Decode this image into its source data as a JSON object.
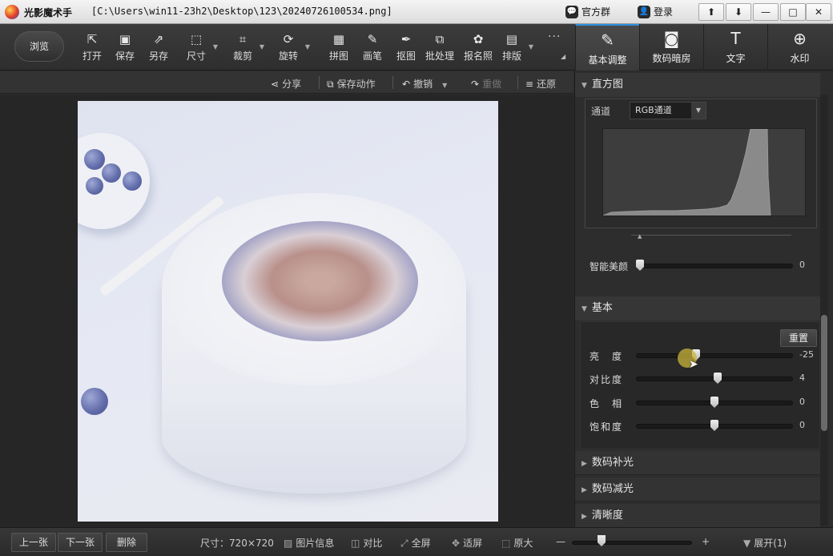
{
  "titlebar": {
    "app_title": "光影魔术手",
    "file_path": "[C:\\Users\\win11-23h2\\Desktop\\123\\20240726100534.png]",
    "official_group": "官方群",
    "login": "登录",
    "window_controls": [
      "⬆",
      "⬇",
      "—",
      "□",
      "✕"
    ]
  },
  "toolbar": {
    "browse_label": "浏览",
    "tools": [
      {
        "label": "打开",
        "icon": "open-icon"
      },
      {
        "label": "保存",
        "icon": "save-icon"
      },
      {
        "label": "另存",
        "icon": "save-as-icon"
      },
      {
        "label": "尺寸",
        "icon": "resize-icon"
      },
      {
        "label": "裁剪",
        "icon": "crop-icon"
      },
      {
        "label": "旋转",
        "icon": "rotate-icon"
      },
      {
        "label": "拼图",
        "icon": "collage-icon"
      },
      {
        "label": "画笔",
        "icon": "brush-icon"
      },
      {
        "label": "抠图",
        "icon": "cutout-icon"
      },
      {
        "label": "批处理",
        "icon": "batch-icon"
      },
      {
        "label": "报名照",
        "icon": "id-photo-icon"
      },
      {
        "label": "排版",
        "icon": "layout-icon"
      }
    ],
    "more": "···"
  },
  "right_tabs": [
    {
      "label": "基本调整",
      "icon": "adjust-icon"
    },
    {
      "label": "数码暗房",
      "icon": "darkroom-icon"
    },
    {
      "label": "文字",
      "icon": "text-icon"
    },
    {
      "label": "水印",
      "icon": "watermark-icon"
    }
  ],
  "subbar": {
    "share": "分享",
    "save_action": "保存动作",
    "undo": "撤销",
    "redo": "重做",
    "restore": "还原"
  },
  "histogram": {
    "title": "直方图",
    "channel_label": "通道",
    "channel_value": "RGB通道",
    "smart_beauty_label": "智能美颜",
    "smart_beauty_value": "0"
  },
  "basic": {
    "title": "基本",
    "reset": "重置",
    "sliders": [
      {
        "label": "亮　度",
        "value": "-25"
      },
      {
        "label": "对比度",
        "value": "4"
      },
      {
        "label": "色　相",
        "value": "0"
      },
      {
        "label": "饱和度",
        "value": "0"
      }
    ]
  },
  "sections": [
    "数码补光",
    "数码减光",
    "清晰度"
  ],
  "bottombar": {
    "prev": "上一张",
    "next": "下一张",
    "delete": "删除",
    "size": "尺寸：720×720",
    "image_info": "图片信息",
    "compare": "对比",
    "fullscreen": "全屏",
    "fit": "适屏",
    "original": "原大",
    "zoom_minus": "—",
    "zoom_plus": "+",
    "expand": "展开(1)"
  }
}
